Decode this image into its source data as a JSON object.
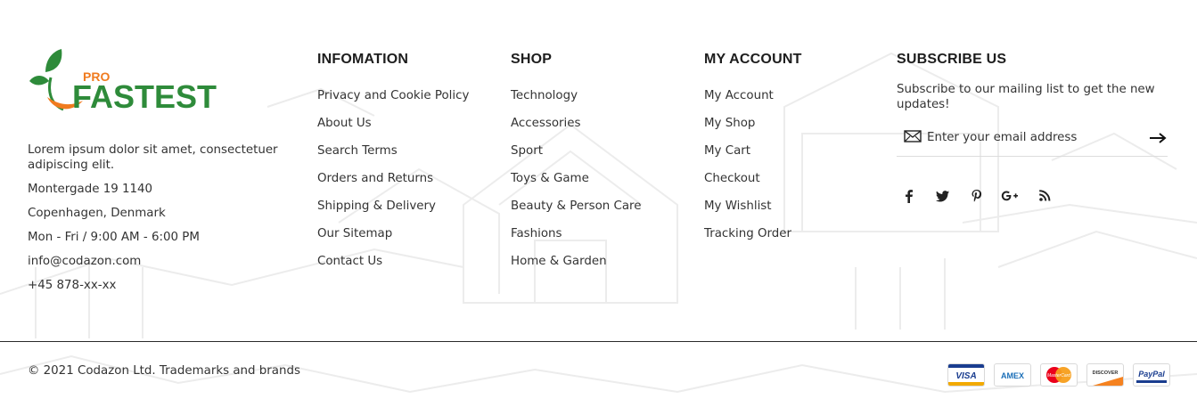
{
  "brand": {
    "logo_small": "PRO",
    "logo_main": "FASTEST",
    "green": "#2e8b3a",
    "orange": "#f07b1f"
  },
  "about": {
    "description_line1": "Lorem ipsum dolor sit amet, consectetuer",
    "description_line2": "adipiscing elit.",
    "address": "Montergade 19 1140",
    "city": "Copenhagen, Denmark",
    "hours": "Mon - Fri / 9:00 AM - 6:00 PM",
    "email": "info@codazon.com",
    "phone": "+45 878-xx-xx"
  },
  "columns": {
    "information": {
      "title": "INFOMATION",
      "links": [
        "Privacy and Cookie Policy",
        "About Us",
        "Search Terms",
        "Orders and Returns",
        "Shipping & Delivery",
        "Our Sitemap",
        "Contact Us"
      ]
    },
    "shop": {
      "title": "SHOP",
      "links": [
        "Technology",
        "Accessories",
        "Sport",
        "Toys & Game",
        "Beauty & Person Care",
        "Fashions",
        "Home & Garden"
      ]
    },
    "account": {
      "title": "MY ACCOUNT",
      "links": [
        "My Account",
        "My Shop",
        "My Cart",
        "Checkout",
        "My Wishlist",
        "Tracking Order"
      ]
    }
  },
  "subscribe": {
    "title": "SUBSCRIBE US",
    "text_line1": "Subscribe to our mailing list to get the new",
    "text_line2": "updates!",
    "placeholder": "Enter your email address",
    "icons": [
      "mail-icon",
      "arrow-right-icon"
    ]
  },
  "social": [
    "facebook-icon",
    "twitter-icon",
    "pinterest-icon",
    "google-plus-icon",
    "rss-icon"
  ],
  "bottom": {
    "copyright": "© 2021 Codazon Ltd. Trademarks and brands",
    "payments": {
      "visa": "VISA",
      "amex": "AMEX",
      "mastercard": "MasterCard",
      "discover": "DISCOVER",
      "paypal": "PayPal"
    }
  }
}
